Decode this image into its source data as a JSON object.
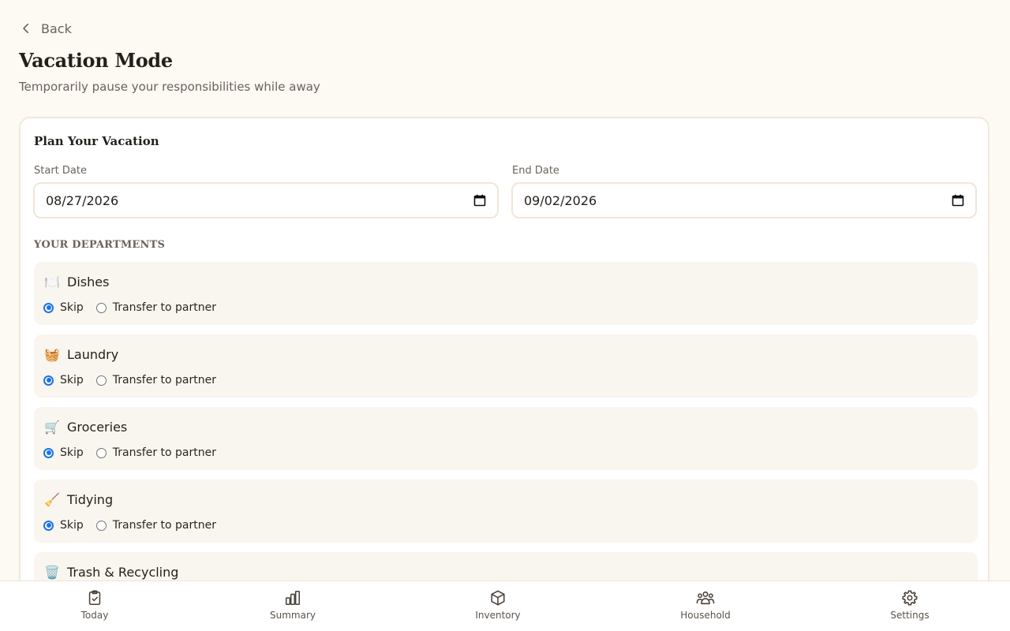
{
  "header": {
    "back_label": "Back",
    "title": "Vacation Mode",
    "subtitle": "Temporarily pause your responsibilities while away"
  },
  "plan": {
    "title": "Plan Your Vacation",
    "start_label": "Start Date",
    "start_value": "08/27/2026",
    "end_label": "End Date",
    "end_value": "09/02/2026"
  },
  "departments": {
    "label": "YOUR DEPARTMENTS",
    "skip_label": "Skip",
    "transfer_label": "Transfer to partner",
    "items": [
      {
        "emoji": "🍽️",
        "name": "Dishes",
        "selected": "Skip"
      },
      {
        "emoji": "🧺",
        "name": "Laundry",
        "selected": "Skip"
      },
      {
        "emoji": "🛒",
        "name": "Groceries",
        "selected": "Skip"
      },
      {
        "emoji": "🧹",
        "name": "Tidying",
        "selected": "Skip"
      },
      {
        "emoji": "🗑️",
        "name": "Trash & Recycling",
        "selected": "Skip"
      }
    ]
  },
  "nav": {
    "items": [
      {
        "label": "Today",
        "icon": "clipboard-check-icon"
      },
      {
        "label": "Summary",
        "icon": "bar-chart-icon"
      },
      {
        "label": "Inventory",
        "icon": "box-icon"
      },
      {
        "label": "Household",
        "icon": "users-icon"
      },
      {
        "label": "Settings",
        "icon": "gear-icon"
      }
    ]
  },
  "colors": {
    "background": "#fdf9f3",
    "card_border": "#f1e9dd",
    "dept_background": "#f9f5ef",
    "radio_accent": "#1a73e8",
    "text_primary": "#231f1b",
    "text_muted": "#6b625a"
  }
}
